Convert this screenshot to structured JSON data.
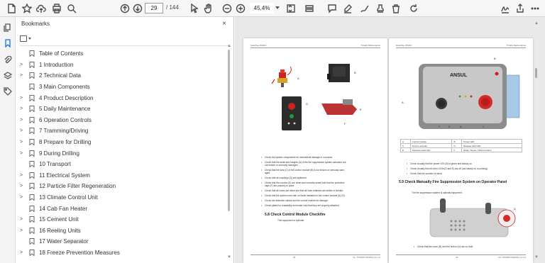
{
  "toolbar": {
    "page_current": "29",
    "page_sep": "/",
    "page_total": "144",
    "zoom": "45,4%"
  },
  "bookmarks": {
    "title": "Bookmarks",
    "close_glyph": "×",
    "items": [
      {
        "label": "Table of Contents",
        "expandable": false
      },
      {
        "label": "1 Introduction",
        "expandable": true
      },
      {
        "label": "2 Technical Data",
        "expandable": true
      },
      {
        "label": "3 Main Components",
        "expandable": false
      },
      {
        "label": "4 Product Description",
        "expandable": true
      },
      {
        "label": "5 Daily Maintenance",
        "expandable": true
      },
      {
        "label": "6 Operation Controls",
        "expandable": true
      },
      {
        "label": "7 Tramming/Driving",
        "expandable": true
      },
      {
        "label": "8 Prepare for Drilling",
        "expandable": true
      },
      {
        "label": "9 During Drilling",
        "expandable": true
      },
      {
        "label": "10 Transport",
        "expandable": false
      },
      {
        "label": "11 Electrical System",
        "expandable": true
      },
      {
        "label": "12 Particle Filter Regeneration",
        "expandable": true
      },
      {
        "label": "13 Climate Control Unit",
        "expandable": true
      },
      {
        "label": "14 Cab Fan Heater",
        "expandable": false
      },
      {
        "label": "15 Cement Unit",
        "expandable": true
      },
      {
        "label": "16 Reeling Units",
        "expandable": true
      },
      {
        "label": "17 Water Separator",
        "expandable": false
      },
      {
        "label": "18 Freeze Prevention Measures",
        "expandable": true
      }
    ]
  },
  "page_left": {
    "header_left": "Gassfree 2018.0",
    "header_right": "5 Daily Maintenance",
    "section": "5.8  Check Control Module Checkfire",
    "section_sub": "This equipment is optional.",
    "footer_left": "28",
    "footer_right": "No. T500050 08/2019 ver.4.0"
  },
  "page_right": {
    "header_left": "Gassfree 2018.0",
    "header_right": "5 Daily Maintenance",
    "section": "5.9  Check Manually Fire Suppression System on Operator Panel",
    "section_sub": "The fire suppression system is optional equipment.",
    "footer_left": "29",
    "footer_right": "No. T500050 08/2019 ver.4.0",
    "brand": "ANSUL"
  },
  "colors": {
    "accent": "#1473e6",
    "panel_bg": "#ffffff",
    "doc_bg": "#e9e9e9",
    "red": "#d62a2a",
    "green": "#1d9a3c"
  }
}
